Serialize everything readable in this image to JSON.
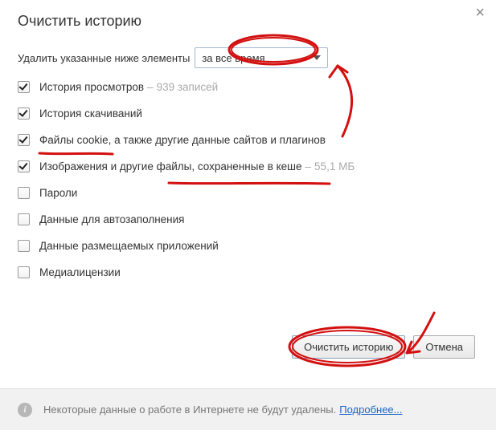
{
  "dialog": {
    "title": "Очистить историю",
    "close_tooltip": "Закрыть"
  },
  "prompt": {
    "label": "Удалить указанные ниже элементы",
    "selected": "за все время"
  },
  "options": {
    "browsing": {
      "checked": true,
      "label": "История просмотров",
      "sub": "939 записей"
    },
    "downloads": {
      "checked": true,
      "label": "История скачиваний"
    },
    "cookies": {
      "checked": true,
      "label": "Файлы cookie, а также другие данные сайтов и плагинов"
    },
    "cache": {
      "checked": true,
      "label": "Изображения и другие файлы, сохраненные в кеше",
      "sub": "55,1 МБ"
    },
    "passwords": {
      "checked": false,
      "label": "Пароли"
    },
    "autofill": {
      "checked": false,
      "label": "Данные для автозаполнения"
    },
    "hosted": {
      "checked": false,
      "label": "Данные размещаемых приложений"
    },
    "media": {
      "checked": false,
      "label": "Медиалицензии"
    }
  },
  "buttons": {
    "clear": "Очистить историю",
    "cancel": "Отмена"
  },
  "footer": {
    "text": "Некоторые данные о работе в Интернете не будут удалены.",
    "link": "Подробнее..."
  },
  "annotation": {
    "color": "#d31010",
    "marks": [
      "circle-time-select",
      "arrow-to-select",
      "underline-cookies",
      "underline-cache",
      "circle-clear-button",
      "arrow-to-clear"
    ]
  }
}
